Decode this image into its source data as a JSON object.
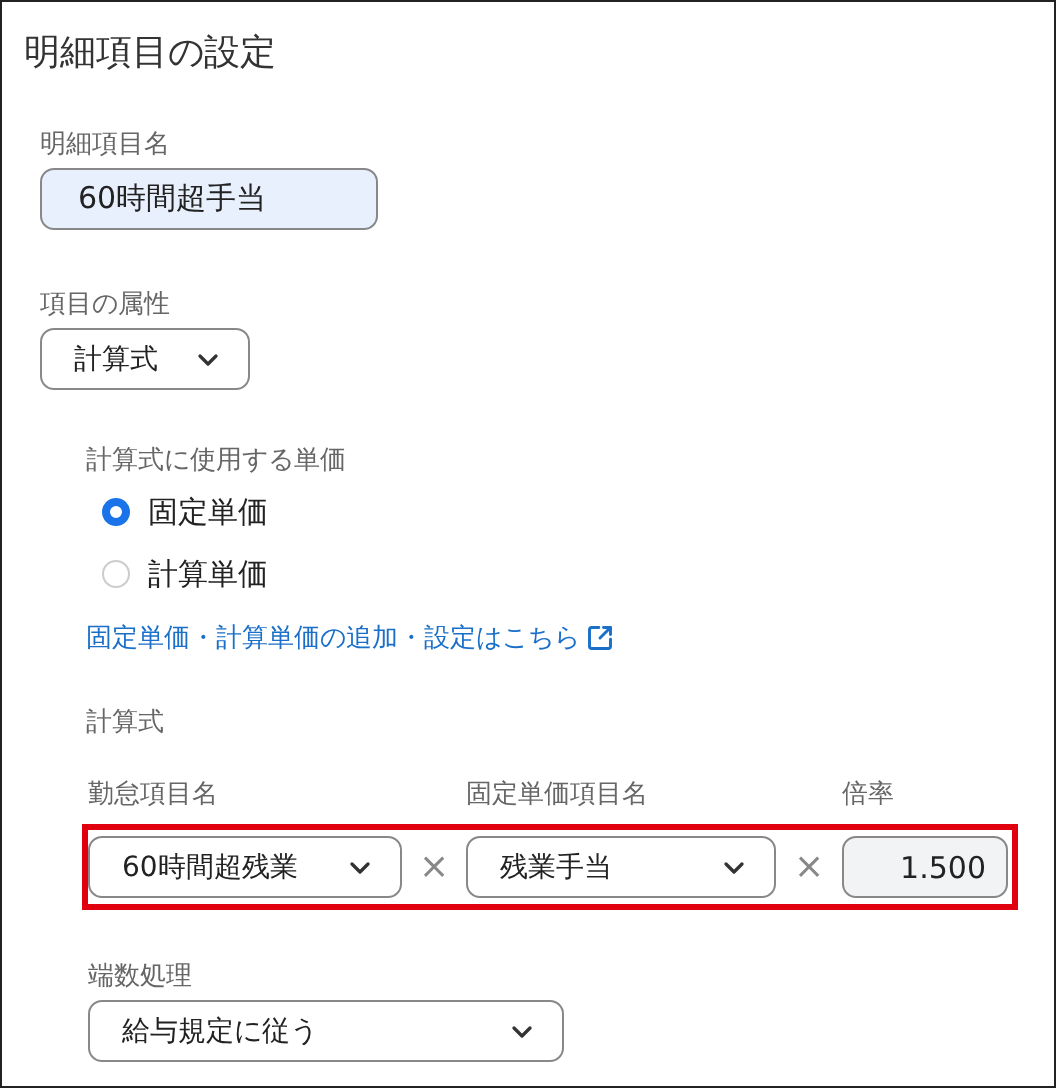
{
  "title": "明細項目の設定",
  "item_name": {
    "label": "明細項目名",
    "value": "60時間超手当"
  },
  "attribute": {
    "label": "項目の属性",
    "value": "計算式"
  },
  "unit_price": {
    "label": "計算式に使用する単価",
    "options": [
      {
        "label": "固定単価",
        "selected": true
      },
      {
        "label": "計算単価",
        "selected": false
      }
    ],
    "link": "固定単価・計算単価の追加・設定はこちら"
  },
  "formula": {
    "label": "計算式",
    "highlighted": true,
    "items": [
      {
        "kind": "select",
        "label": "勤怠項目名",
        "value": "60時間超残業"
      },
      {
        "kind": "operator",
        "symbol": "×"
      },
      {
        "kind": "select",
        "label": "固定単価項目名",
        "value": "残業手当"
      },
      {
        "kind": "operator",
        "symbol": "×"
      },
      {
        "kind": "number",
        "label": "倍率",
        "value": "1.500"
      }
    ]
  },
  "rounding": {
    "label": "端数処理",
    "value": "給与規定に従う"
  }
}
